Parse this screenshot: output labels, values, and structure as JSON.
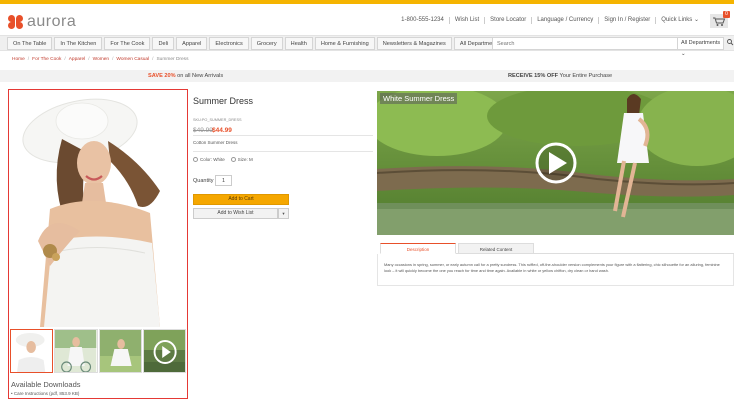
{
  "brand": {
    "name": "aurora",
    "accent": "#e8502a",
    "topbar_color": "#f5b400"
  },
  "header": {
    "links": [
      "1-800-555-1234",
      "Wish List",
      "Store Locator",
      "Language / Currency",
      "Sign In / Register",
      "Quick Links ⌄"
    ],
    "cart_count": "0",
    "cart_icon": "shopping-cart-icon"
  },
  "nav": {
    "tabs": [
      "On The Table",
      "In The Kitchen",
      "For The Cook",
      "Deli",
      "Apparel",
      "Electronics",
      "Grocery",
      "Health",
      "Home & Furnishing",
      "Newsletters & Magazines",
      "All Departments"
    ],
    "search_placeholder": "Search",
    "search_department": "All Departments ⌄",
    "search_icon": "search-icon"
  },
  "breadcrumb": [
    "Home",
    "For The Cook",
    "Apparel",
    "Women",
    "Women Casual",
    "Summer Dress"
  ],
  "promo": {
    "left_bold": "SAVE 20%",
    "left_rest": " on all New Arrivals",
    "right_bold": "RECEIVE 15% OFF",
    "right_rest": " Your Entire Purchase"
  },
  "product": {
    "title": "Summer Dress",
    "sku": "SKU:PO_SUMMER_DRESS",
    "old_price": "$49.99",
    "new_price": "$44.99",
    "short_desc": "Cotton Summer Dress",
    "options": [
      "Color: White",
      "Size: M"
    ],
    "quantity_label": "Quantity",
    "quantity": "1",
    "add_to_cart": "Add to Cart",
    "add_to_wishlist": "Add to Wish List"
  },
  "gallery": {
    "downloads_title": "Available Downloads",
    "downloads": [
      "Care Instructions (pdf, 853.9 KB)"
    ]
  },
  "video": {
    "title": "White Summer Dress"
  },
  "tabs": {
    "items": [
      "Description",
      "Related Content"
    ],
    "description": "Many occasions in spring, summer, or early autumn call for a pretty sundress. This ruffled, off-the-shoulder version complements your figure with a flattering, chic silhouette for an alluring, feminine look – it will quickly become the one you reach for time and time again. Available in white or yellow chiffon, dry clean or hand wash."
  }
}
